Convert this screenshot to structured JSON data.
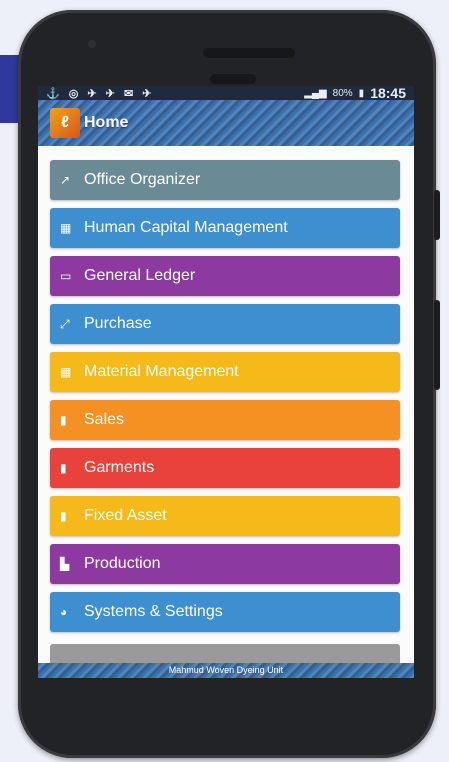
{
  "status_bar": {
    "left_icons": "⚓ ◎ ✈ ✈ ✉ ✈",
    "battery": "80%",
    "time": "18:45"
  },
  "app_bar": {
    "title": "Home"
  },
  "menu": [
    {
      "label": "Office Organizer",
      "icon": "chart-line-icon",
      "glyph": "↗",
      "color": "#6a8a95"
    },
    {
      "label": "Human Capital Management",
      "icon": "users-icon",
      "glyph": "▦",
      "color": "#3d8fd0"
    },
    {
      "label": "General Ledger",
      "icon": "ledger-icon",
      "glyph": "▭",
      "color": "#8d3aa0"
    },
    {
      "label": "Purchase",
      "icon": "purchase-icon",
      "glyph": "⤢",
      "color": "#3d8fd0"
    },
    {
      "label": "Material Management",
      "icon": "material-icon",
      "glyph": "▦",
      "color": "#f5b91a"
    },
    {
      "label": "Sales",
      "icon": "bar-chart-icon",
      "glyph": "▮",
      "color": "#f49122"
    },
    {
      "label": "Garments",
      "icon": "bar-chart-icon",
      "glyph": "▮",
      "color": "#e8423a"
    },
    {
      "label": "Fixed Asset",
      "icon": "bar-chart-icon",
      "glyph": "▮",
      "color": "#f5b91a"
    },
    {
      "label": "Production",
      "icon": "production-icon",
      "glyph": "▙",
      "color": "#8d3aa0"
    },
    {
      "label": "Systems & Settings",
      "icon": "settings-icon",
      "glyph": "◕",
      "color": "#3d8fd0"
    }
  ],
  "footer": {
    "text": "Mahmud Woven Dyeing Unit"
  }
}
